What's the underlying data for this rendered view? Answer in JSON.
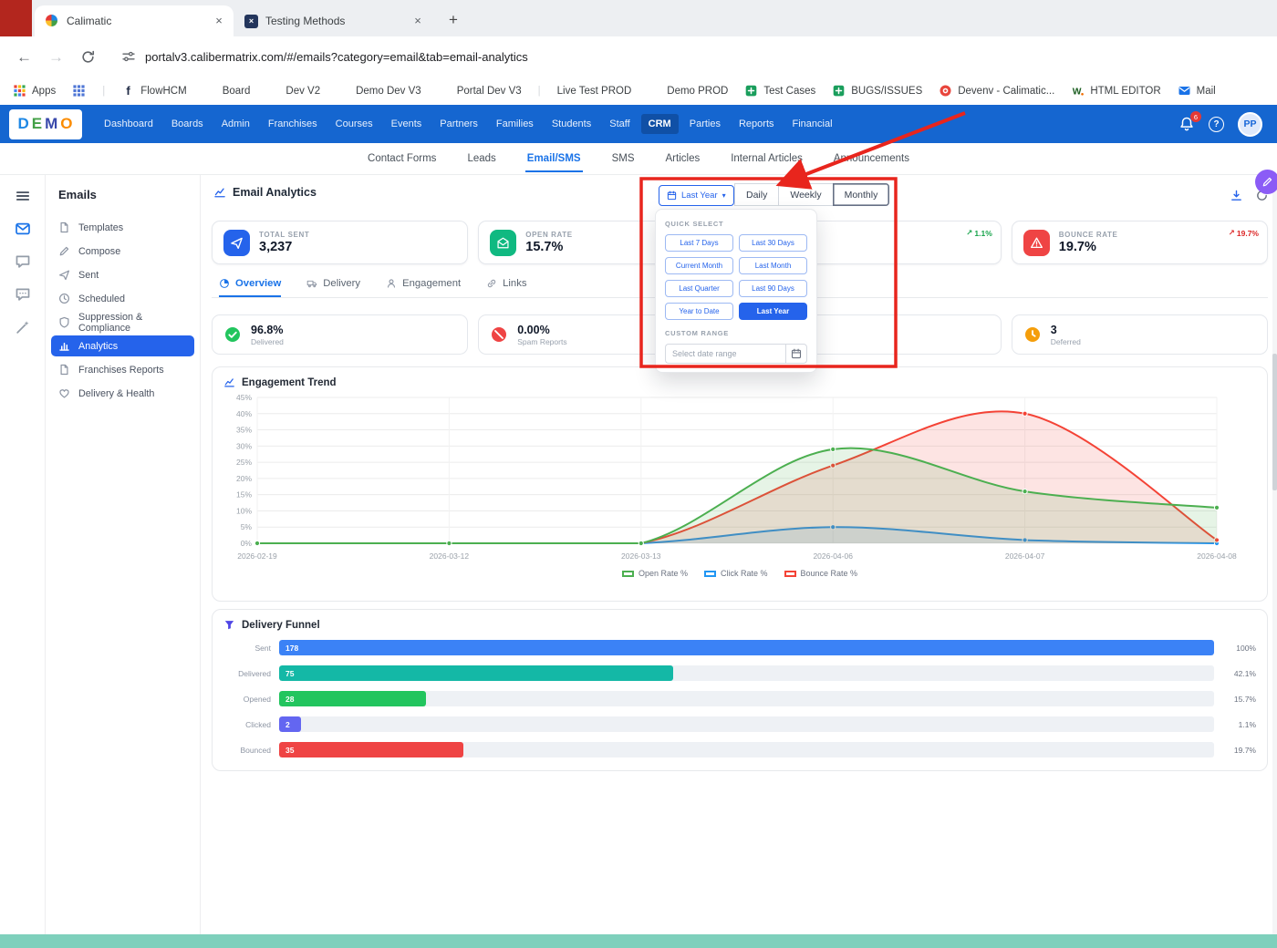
{
  "browser": {
    "tabs": [
      {
        "title": "Calimatic"
      },
      {
        "title": "Testing Methods"
      }
    ],
    "url": "portalv3.calibermatrix.com/#/emails?category=email&tab=email-analytics",
    "bookmarks": [
      {
        "label": "Apps",
        "icon": "grid"
      },
      {
        "label": "",
        "icon": "grid2"
      },
      {
        "label": "|",
        "icon": "",
        "color": "#d5d8dc"
      },
      {
        "label": "FlowHCM",
        "icon": "f-logo"
      },
      {
        "label": "Board",
        "icon": "cali"
      },
      {
        "label": "Dev V2",
        "icon": "cali"
      },
      {
        "label": "Demo Dev V3",
        "icon": "cali"
      },
      {
        "label": "Portal Dev V3",
        "icon": "cali"
      },
      {
        "label": "|",
        "icon": "",
        "color": "#d5d8dc"
      },
      {
        "label": "Live Test PROD",
        "icon": ""
      },
      {
        "label": "Demo PROD",
        "icon": "cali"
      },
      {
        "label": "Test Cases",
        "icon": "board-green"
      },
      {
        "label": "BUGS/ISSUES",
        "icon": "board-green"
      },
      {
        "label": "Devenv - Calimatic...",
        "icon": "target-red"
      },
      {
        "label": "HTML EDITOR",
        "icon": "w-logo"
      },
      {
        "label": "Mail",
        "icon": "mail-solid"
      }
    ]
  },
  "app_header": {
    "logo_letters": [
      {
        "ch": "D",
        "color": "#1e88e5"
      },
      {
        "ch": "E",
        "color": "#43a047"
      },
      {
        "ch": "M",
        "color": "#3949ab"
      },
      {
        "ch": "O",
        "color": "#fb8c00"
      }
    ],
    "nav": [
      "Dashboard",
      "Boards",
      "Admin",
      "Franchises",
      "Courses",
      "Events",
      "Partners",
      "Families",
      "Students",
      "Staff",
      "CRM",
      "Parties",
      "Reports",
      "Financial"
    ],
    "active_nav": "CRM",
    "notification_count": "6",
    "help_label": "?",
    "avatar": "PP"
  },
  "subnav": {
    "items": [
      "Contact Forms",
      "Leads",
      "Email/SMS",
      "SMS",
      "Articles",
      "Internal Articles",
      "Announcements"
    ],
    "active": "Email/SMS"
  },
  "rail": {
    "icons": [
      {
        "icon": "menu",
        "color": "#374151"
      },
      {
        "icon": "mail",
        "color": "#1a73e8"
      },
      {
        "icon": "chat",
        "color": "#939ca8"
      },
      {
        "icon": "chat-dots",
        "color": "#939ca8"
      },
      {
        "icon": "wand",
        "color": "#939ca8"
      }
    ]
  },
  "sidebar": {
    "title": "Emails",
    "active": "Analytics",
    "items": [
      {
        "label": "Templates",
        "icon": "file"
      },
      {
        "label": "Compose",
        "icon": "pencil"
      },
      {
        "label": "Sent",
        "icon": "send"
      },
      {
        "label": "Scheduled",
        "icon": "clock"
      },
      {
        "label": "Suppression & Compliance",
        "icon": "shield"
      },
      {
        "label": "Analytics",
        "icon": "chart"
      },
      {
        "label": "Franchises Reports",
        "icon": "doc"
      },
      {
        "label": "Delivery & Health",
        "icon": "heart"
      }
    ]
  },
  "main": {
    "title": "Email Analytics",
    "range_label": "Last Year",
    "views": [
      "Daily",
      "Weekly",
      "Monthly"
    ],
    "active_view": "Monthly",
    "stats": [
      {
        "label": "TOTAL SENT",
        "value": "3,237",
        "icon": "send",
        "icon_bg": "#2563eb",
        "badge": "",
        "badge_color": ""
      },
      {
        "label": "OPEN RATE",
        "value": "15.7%",
        "icon": "mail-open",
        "icon_bg": "#10b981",
        "badge": "",
        "badge_color": ""
      },
      {
        "label": "",
        "value": "",
        "icon": "",
        "icon_bg": "",
        "badge": "1.1%",
        "badge_color": "#16a34a"
      },
      {
        "label": "BOUNCE RATE",
        "value": "19.7%",
        "icon": "warn",
        "icon_bg": "#ef4444",
        "badge": "19.7%",
        "badge_color": "#dc2626"
      }
    ],
    "tabs": [
      {
        "label": "Overview",
        "icon": "pie"
      },
      {
        "label": "Delivery",
        "icon": "truck"
      },
      {
        "label": "Engagement",
        "icon": "person"
      },
      {
        "label": "Links",
        "icon": "link"
      }
    ],
    "active_tab": "Overview",
    "substats": [
      {
        "value": "96.8%",
        "label": "Delivered",
        "icon": "check-fill",
        "icon_color": "#22c55e"
      },
      {
        "value": "0.00%",
        "label": "Spam Reports",
        "icon": "ban-fill",
        "icon_color": "#ef4444"
      },
      {
        "value": "",
        "label": "",
        "icon": "",
        "icon_color": ""
      },
      {
        "value": "3",
        "label": "Deferred",
        "icon": "clock-fill",
        "icon_color": "#f59e0b"
      }
    ],
    "dropdown": {
      "quick_label": "QUICK SELECT",
      "options": [
        "Last 7 Days",
        "Last 30 Days",
        "Current Month",
        "Last Month",
        "Last Quarter",
        "Last 90 Days",
        "Year to Date",
        "Last Year"
      ],
      "selected": "Last Year",
      "custom_label": "CUSTOM RANGE",
      "placeholder": "Select date range"
    }
  },
  "chart_data": [
    {
      "type": "area",
      "title": "Engagement Trend",
      "x": [
        "2026-02-19",
        "2026-03-12",
        "2026-03-13",
        "2026-04-06",
        "2026-04-07",
        "2026-04-08"
      ],
      "ylim": [
        0,
        45
      ],
      "ytick_step": 5,
      "grid": true,
      "legend_position": "bottom",
      "series": [
        {
          "name": "Open Rate %",
          "color": "#4caf50",
          "values": [
            0,
            0,
            0,
            29,
            16,
            11
          ]
        },
        {
          "name": "Click Rate %",
          "color": "#2196f3",
          "values": [
            0,
            0,
            0,
            5,
            1,
            0
          ]
        },
        {
          "name": "Bounce Rate %",
          "color": "#f44336",
          "values": [
            0,
            0,
            0,
            24,
            40,
            1
          ]
        }
      ]
    },
    {
      "type": "bar",
      "title": "Delivery Funnel",
      "orientation": "horizontal",
      "rows": [
        {
          "label": "Sent",
          "value": "178",
          "percent": "100%"
        },
        {
          "label": "Delivered",
          "value": "75",
          "percent": "42.1%"
        },
        {
          "label": "Opened",
          "value": "28",
          "percent": "15.7%"
        },
        {
          "label": "Clicked",
          "value": "2",
          "percent": "1.1%"
        },
        {
          "label": "Bounced",
          "value": "35",
          "percent": "19.7%"
        }
      ],
      "pcts": [
        100,
        42.1,
        15.7,
        1.1,
        19.7
      ],
      "colors": [
        "#3b82f6",
        "#14b8a6",
        "#22c55e",
        "#6366f1",
        "#ef4444"
      ]
    }
  ]
}
